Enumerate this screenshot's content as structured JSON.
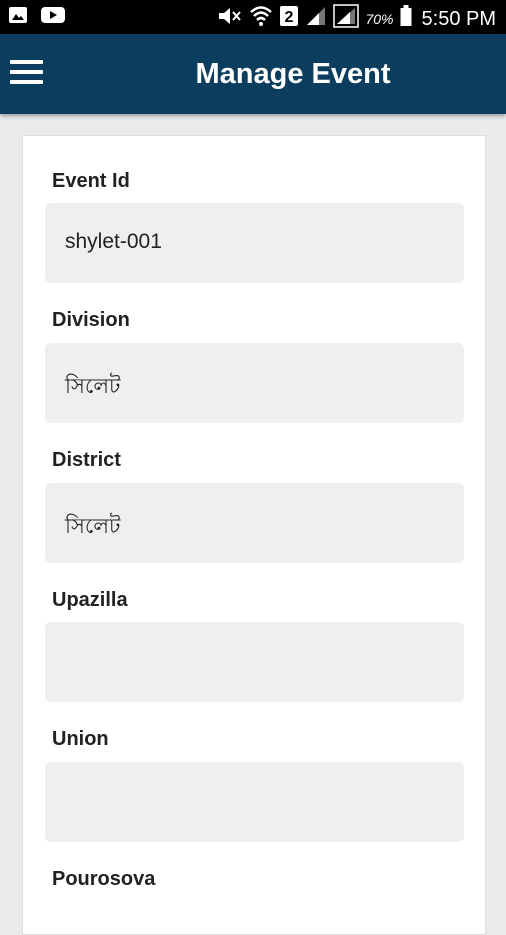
{
  "status_bar": {
    "left_icons": [
      "gallery-icon",
      "youtube-icon"
    ],
    "sim_label": "2",
    "battery_percent": "70%",
    "time": "5:50 PM"
  },
  "app_bar": {
    "title": "Manage Event",
    "menu_icon": "hamburger-menu-icon"
  },
  "form": {
    "event_id": {
      "label": "Event Id",
      "value": "shylet-001"
    },
    "division": {
      "label": "Division",
      "value": "সিলেট"
    },
    "district": {
      "label": "District",
      "value": "সিলেট"
    },
    "upazilla": {
      "label": "Upazilla",
      "value": ""
    },
    "union": {
      "label": "Union",
      "value": ""
    },
    "pourosova": {
      "label": "Pourosova"
    }
  }
}
